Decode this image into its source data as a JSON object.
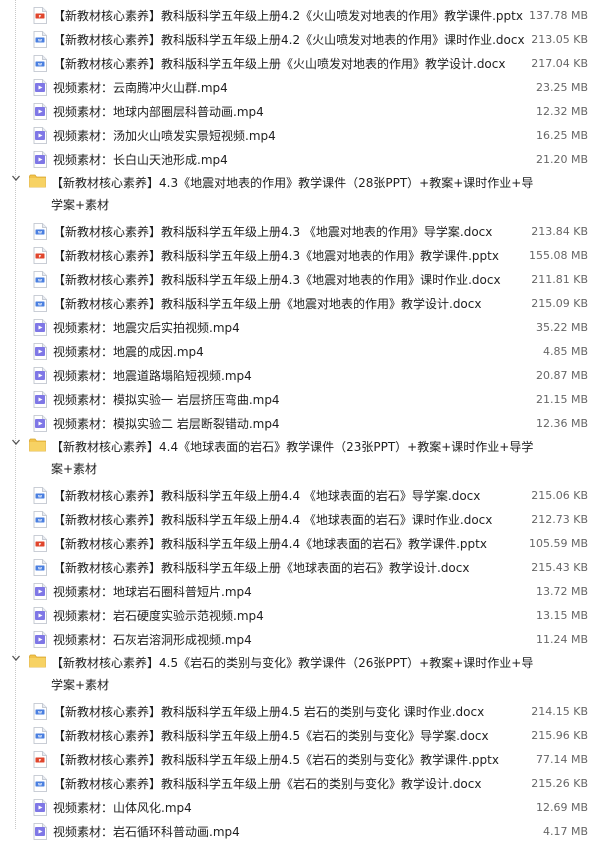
{
  "colors": {
    "doc": "#4a7fe0",
    "ppt": "#e0452c",
    "video": "#7f77e6",
    "folder": "#f2c34b"
  },
  "rows": [
    {
      "kind": "file",
      "type": "ppt",
      "name": "【新教材核心素养】教科版科学五年级上册4.2《火山喷发对地表的作用》教学课件.pptx",
      "size": "137.78 MB"
    },
    {
      "kind": "file",
      "type": "doc",
      "name": "【新教材核心素养】教科版科学五年级上册4.2《火山喷发对地表的作用》课时作业.docx",
      "size": "213.05 KB"
    },
    {
      "kind": "file",
      "type": "doc",
      "name": "【新教材核心素养】教科版科学五年级上册《火山喷发对地表的作用》教学设计.docx",
      "size": "217.04 KB"
    },
    {
      "kind": "file",
      "type": "video",
      "name": "视频素材：云南腾冲火山群.mp4",
      "size": "23.25 MB"
    },
    {
      "kind": "file",
      "type": "video",
      "name": "视频素材：地球内部圈层科普动画.mp4",
      "size": "12.32 MB"
    },
    {
      "kind": "file",
      "type": "video",
      "name": "视频素材：汤加火山喷发实景短视频.mp4",
      "size": "16.25 MB"
    },
    {
      "kind": "file",
      "type": "video",
      "name": "视频素材：长白山天池形成.mp4",
      "size": "21.20 MB"
    },
    {
      "kind": "folder",
      "name": "【新教材核心素养】4.3《地震对地表的作用》教学课件（28张PPT）+教案+课时作业+导",
      "name2": "学案+素材"
    },
    {
      "kind": "file",
      "type": "doc",
      "name": "【新教材核心素养】教科版科学五年级上册4.3 《地震对地表的作用》导学案.docx",
      "size": "213.84 KB"
    },
    {
      "kind": "file",
      "type": "ppt",
      "name": "【新教材核心素养】教科版科学五年级上册4.3《地震对地表的作用》教学课件.pptx",
      "size": "155.08 MB"
    },
    {
      "kind": "file",
      "type": "doc",
      "name": "【新教材核心素养】教科版科学五年级上册4.3《地震对地表的作用》课时作业.docx",
      "size": "211.81 KB"
    },
    {
      "kind": "file",
      "type": "doc",
      "name": "【新教材核心素养】教科版科学五年级上册《地震对地表的作用》教学设计.docx",
      "size": "215.09 KB"
    },
    {
      "kind": "file",
      "type": "video",
      "name": "视频素材：地震灾后实拍视频.mp4",
      "size": "35.22 MB"
    },
    {
      "kind": "file",
      "type": "video",
      "name": "视频素材：地震的成因.mp4",
      "size": "4.85 MB"
    },
    {
      "kind": "file",
      "type": "video",
      "name": "视频素材：地震道路塌陷短视频.mp4",
      "size": "20.87 MB"
    },
    {
      "kind": "file",
      "type": "video",
      "name": "视频素材：模拟实验一 岩层挤压弯曲.mp4",
      "size": "21.15 MB"
    },
    {
      "kind": "file",
      "type": "video",
      "name": "视频素材：模拟实验二 岩层断裂错动.mp4",
      "size": "12.36 MB"
    },
    {
      "kind": "folder",
      "name": "【新教材核心素养】4.4《地球表面的岩石》教学课件（23张PPT）+教案+课时作业+导学",
      "name2": "案+素材"
    },
    {
      "kind": "file",
      "type": "doc",
      "name": "【新教材核心素养】教科版科学五年级上册4.4 《地球表面的岩石》导学案.docx",
      "size": "215.06 KB"
    },
    {
      "kind": "file",
      "type": "doc",
      "name": "【新教材核心素养】教科版科学五年级上册4.4 《地球表面的岩石》课时作业.docx",
      "size": "212.73 KB"
    },
    {
      "kind": "file",
      "type": "ppt",
      "name": "【新教材核心素养】教科版科学五年级上册4.4《地球表面的岩石》教学课件.pptx",
      "size": "105.59 MB"
    },
    {
      "kind": "file",
      "type": "doc",
      "name": "【新教材核心素养】教科版科学五年级上册《地球表面的岩石》教学设计.docx",
      "size": "215.43 KB"
    },
    {
      "kind": "file",
      "type": "video",
      "name": "视频素材：地球岩石圈科普短片.mp4",
      "size": "13.72 MB"
    },
    {
      "kind": "file",
      "type": "video",
      "name": "视频素材：岩石硬度实验示范视频.mp4",
      "size": "13.15 MB"
    },
    {
      "kind": "file",
      "type": "video",
      "name": "视频素材：石灰岩溶洞形成视频.mp4",
      "size": "11.24 MB"
    },
    {
      "kind": "folder",
      "name": "【新教材核心素养】4.5《岩石的类别与变化》教学课件（26张PPT）+教案+课时作业+导",
      "name2": "学案+素材"
    },
    {
      "kind": "file",
      "type": "doc",
      "name": "【新教材核心素养】教科版科学五年级上册4.5 岩石的类别与变化 课时作业.docx",
      "size": "214.15 KB"
    },
    {
      "kind": "file",
      "type": "doc",
      "name": "【新教材核心素养】教科版科学五年级上册4.5《岩石的类别与变化》导学案.docx",
      "size": "215.96 KB"
    },
    {
      "kind": "file",
      "type": "ppt",
      "name": "【新教材核心素养】教科版科学五年级上册4.5《岩石的类别与变化》教学课件.pptx",
      "size": "77.14 MB"
    },
    {
      "kind": "file",
      "type": "doc",
      "name": "【新教材核心素养】教科版科学五年级上册《岩石的类别与变化》教学设计.docx",
      "size": "215.26 KB"
    },
    {
      "kind": "file",
      "type": "video",
      "name": "视频素材：山体风化.mp4",
      "size": "12.69 MB"
    },
    {
      "kind": "file",
      "type": "video",
      "name": "视频素材：岩石循环科普动画.mp4",
      "size": "4.17 MB"
    }
  ]
}
